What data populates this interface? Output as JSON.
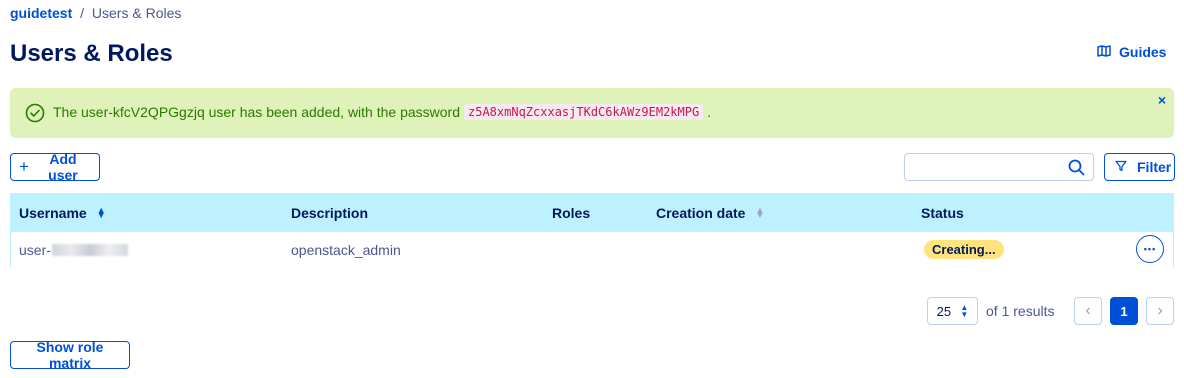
{
  "breadcrumb": {
    "project": "guidetest",
    "separator": "/",
    "current": "Users & Roles"
  },
  "page_title": "Users & Roles",
  "guides_label": "Guides",
  "alert": {
    "text_before": "The user-kfcV2QPGgzjq user has been added, with the password",
    "password": "z5A8xmNqZcxxasjTKdC6kAWz9EM2kMPG",
    "text_after": ".",
    "close": "×",
    "color": "#dff2b9"
  },
  "toolbar": {
    "add_user_icon": "+",
    "add_user_label": "Add user",
    "search_value": "",
    "filter_label": "Filter"
  },
  "table": {
    "columns": {
      "username": "Username",
      "description": "Description",
      "roles": "Roles",
      "creation_date": "Creation date",
      "status": "Status"
    },
    "rows": [
      {
        "username_prefix": "user-",
        "description": "openstack_admin",
        "roles": "",
        "creation_date": "",
        "status": "Creating...",
        "menu": "•••"
      }
    ]
  },
  "pagination": {
    "page_size": "25",
    "results_text": "of 1 results",
    "current_page": "1",
    "prev": "‹",
    "next": "›"
  },
  "show_role_matrix_label": "Show role matrix",
  "colors": {
    "accent": "#0050d7",
    "header_bg": "#bef1ff",
    "badge": "#ffe37d",
    "title": "#00185e"
  }
}
